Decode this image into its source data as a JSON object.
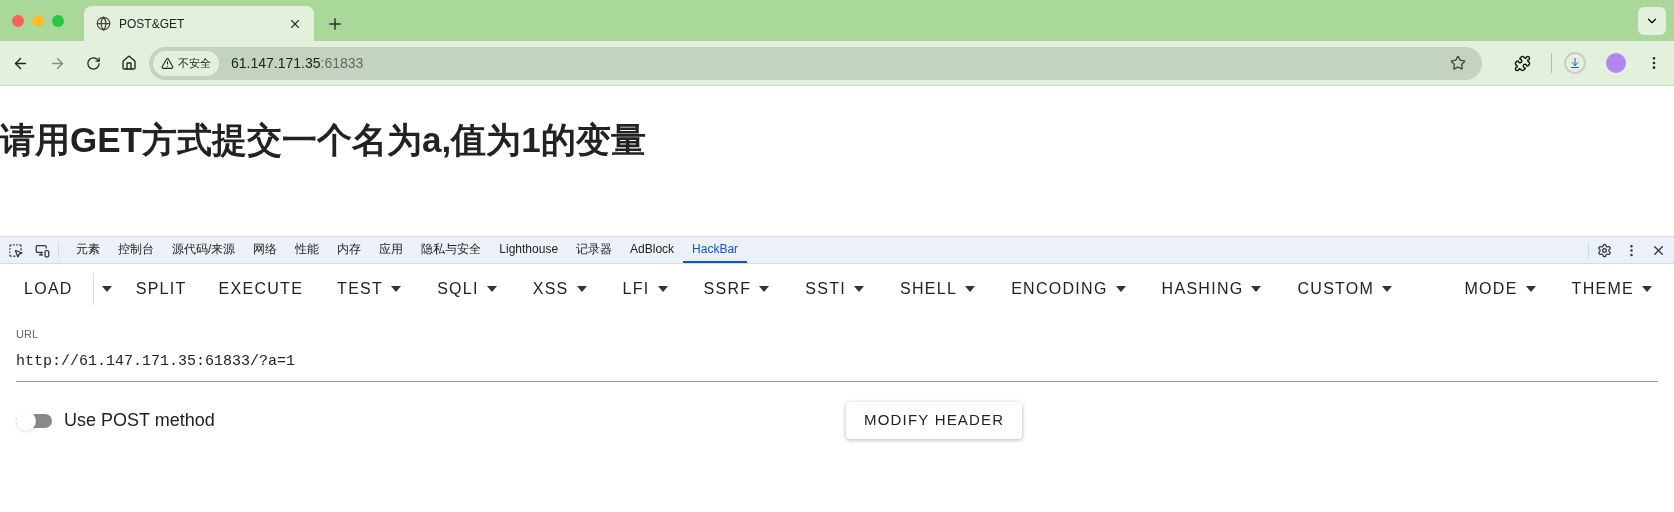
{
  "browser": {
    "tab": {
      "title": "POST&GET"
    },
    "address": {
      "security": "不安全",
      "host": "61.147.171.35",
      "port": ":61833"
    }
  },
  "page": {
    "heading": "请用GET方式提交一个名为a,值为1的变量"
  },
  "devtools": {
    "tabs": [
      {
        "label": "元素",
        "selected": false
      },
      {
        "label": "控制台",
        "selected": false
      },
      {
        "label": "源代码/来源",
        "selected": false
      },
      {
        "label": "网络",
        "selected": false
      },
      {
        "label": "性能",
        "selected": false
      },
      {
        "label": "内存",
        "selected": false
      },
      {
        "label": "应用",
        "selected": false
      },
      {
        "label": "隐私与安全",
        "selected": false
      },
      {
        "label": "Lighthouse",
        "selected": false
      },
      {
        "label": "记录器",
        "selected": false
      },
      {
        "label": "AdBlock",
        "selected": false
      },
      {
        "label": "HackBar",
        "selected": true
      }
    ]
  },
  "hackbar": {
    "menu": [
      {
        "label": "LOAD",
        "kind": "split"
      },
      {
        "label": "SPLIT",
        "kind": "plain"
      },
      {
        "label": "EXECUTE",
        "kind": "plain"
      },
      {
        "label": "TEST",
        "kind": "dropdown"
      },
      {
        "label": "SQLI",
        "kind": "dropdown"
      },
      {
        "label": "XSS",
        "kind": "dropdown"
      },
      {
        "label": "LFI",
        "kind": "dropdown"
      },
      {
        "label": "SSRF",
        "kind": "dropdown"
      },
      {
        "label": "SSTI",
        "kind": "dropdown"
      },
      {
        "label": "SHELL",
        "kind": "dropdown"
      },
      {
        "label": "ENCODING",
        "kind": "dropdown"
      },
      {
        "label": "HASHING",
        "kind": "dropdown"
      },
      {
        "label": "CUSTOM",
        "kind": "dropdown"
      }
    ],
    "menu_right": [
      {
        "label": "MODE",
        "kind": "dropdown"
      },
      {
        "label": "THEME",
        "kind": "dropdown"
      }
    ],
    "url": {
      "label": "URL",
      "value": "http://61.147.171.35:61833/?a=1"
    },
    "post_toggle": {
      "label": "Use POST method",
      "on": false
    },
    "modify_header": "MODIFY HEADER"
  }
}
